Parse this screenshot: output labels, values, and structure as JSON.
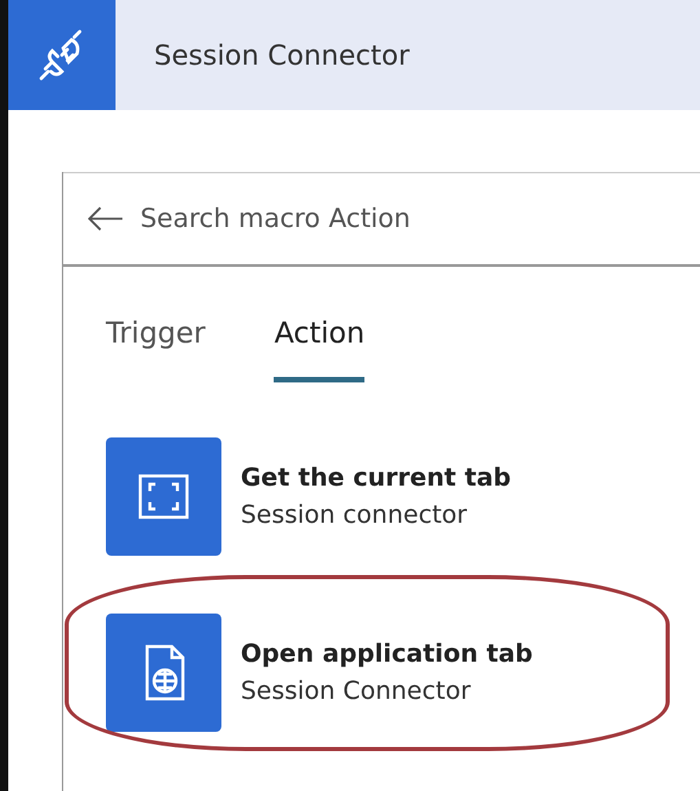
{
  "header": {
    "title": "Session Connector"
  },
  "search": {
    "placeholder": "Search macro Action"
  },
  "tabs": [
    {
      "label": "Trigger",
      "selected": false
    },
    {
      "label": "Action",
      "selected": true
    }
  ],
  "actions": [
    {
      "kind": "focus",
      "title": "Get the current tab",
      "subtitle": "Session connector",
      "highlighted": false
    },
    {
      "kind": "webpage",
      "title": "Open application tab",
      "subtitle": "Session Connector",
      "highlighted": true
    }
  ]
}
